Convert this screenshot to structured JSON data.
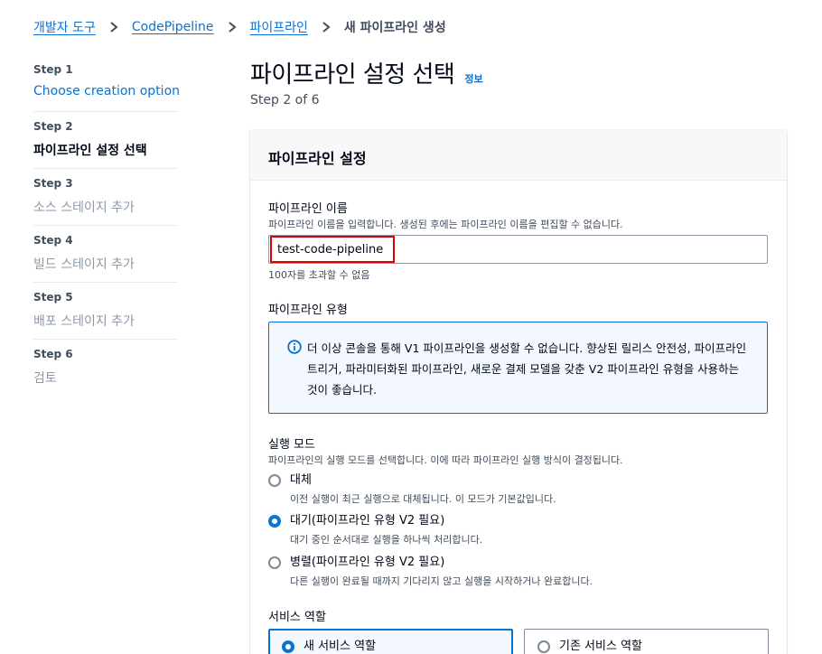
{
  "breadcrumb": {
    "items": [
      "개발자 도구",
      "CodePipeline",
      "파이프라인"
    ],
    "current": "새 파이프라인 생성"
  },
  "steps": [
    {
      "label": "Step 1",
      "title": "Choose creation option",
      "state": "link"
    },
    {
      "label": "Step 2",
      "title": "파이프라인 설정 선택",
      "state": "active"
    },
    {
      "label": "Step 3",
      "title": "소스 스테이지 추가",
      "state": "disabled"
    },
    {
      "label": "Step 4",
      "title": "빌드 스테이지 추가",
      "state": "disabled"
    },
    {
      "label": "Step 5",
      "title": "배포 스테이지 추가",
      "state": "disabled"
    },
    {
      "label": "Step 6",
      "title": "검토",
      "state": "disabled"
    }
  ],
  "header": {
    "title": "파이프라인 설정 선택",
    "info": "정보",
    "step_of": "Step 2 of 6"
  },
  "settings": {
    "title": "파이프라인 설정",
    "name": {
      "label": "파이프라인 이름",
      "description": "파이프라인 이름을 입력합니다. 생성된 후에는 파이프라인 이름을 편집할 수 없습니다.",
      "value": "test-code-pipeline",
      "constraint": "100자를 초과할 수 없음"
    },
    "type": {
      "label": "파이프라인 유형",
      "alert": "더 이상 콘솔을 통해 V1 파이프라인을 생성할 수 없습니다. 향상된 릴리스 안전성, 파이프라인 트리거, 파라미터화된 파이프라인, 새로운 결제 모델을 갖춘 V2 파이프라인 유형을 사용하는 것이 좋습니다."
    },
    "mode": {
      "label": "실행 모드",
      "description": "파이프라인의 실행 모드를 선택합니다. 이에 따라 파이프라인 실행 방식이 결정됩니다.",
      "options": [
        {
          "label": "대체",
          "description": "이전 실행이 최근 실행으로 대체됩니다. 이 모드가 기본값입니다.",
          "checked": false
        },
        {
          "label": "대기(파이프라인 유형 V2 필요)",
          "description": "대기 중인 순서대로 실행을 하나씩 처리합니다.",
          "checked": true
        },
        {
          "label": "병렬(파이프라인 유형 V2 필요)",
          "description": "다른 실행이 완료될 때까지 기다리지 않고 실행을 시작하거나 완료합니다.",
          "checked": false
        }
      ]
    },
    "role": {
      "label": "서비스 역할",
      "options": [
        {
          "label": "새 서비스 역할",
          "checked": true
        },
        {
          "label": "기존 서비스 역할",
          "checked": false
        }
      ]
    }
  },
  "colors": {
    "link": "#0972d3",
    "text": "#000716",
    "muted": "#414d5c",
    "disabled": "#8d99a8",
    "highlight": "#e00000"
  }
}
